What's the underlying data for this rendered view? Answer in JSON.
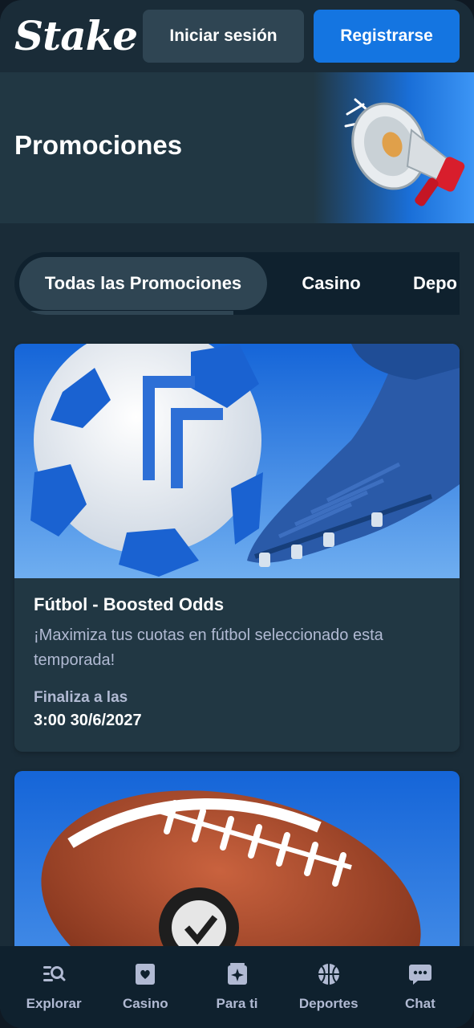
{
  "header": {
    "logo": "Stake",
    "login_label": "Iniciar sesión",
    "register_label": "Registrarse"
  },
  "hero": {
    "title": "Promociones"
  },
  "tabs": [
    {
      "label": "Todas las Promociones",
      "active": true
    },
    {
      "label": "Casino",
      "active": false
    },
    {
      "label": "Depo",
      "active": false
    }
  ],
  "promotions": [
    {
      "title": "Fútbol - Boosted Odds",
      "description": "¡Maximiza tus cuotas en fútbol seleccionado esta temporada!",
      "ends_label": "Finaliza a las",
      "ends_date": "3:00 30/6/2027"
    }
  ],
  "bottom_nav": [
    {
      "label": "Explorar",
      "icon": "search-list-icon"
    },
    {
      "label": "Casino",
      "icon": "card-heart-icon"
    },
    {
      "label": "Para ti",
      "icon": "sparkle-card-icon"
    },
    {
      "label": "Deportes",
      "icon": "basketball-icon"
    },
    {
      "label": "Chat",
      "icon": "chat-icon"
    }
  ],
  "colors": {
    "background": "#1a2c38",
    "panel": "#213743",
    "dark": "#0f212e",
    "button_grey": "#2f4553",
    "accent_blue": "#1475e1",
    "muted_text": "#b1bad3"
  }
}
